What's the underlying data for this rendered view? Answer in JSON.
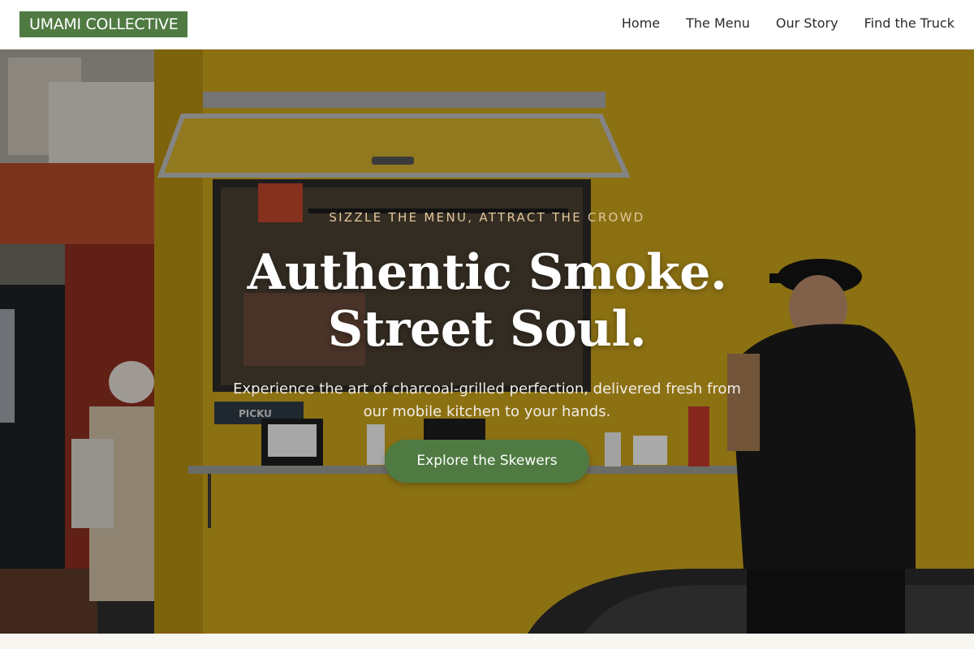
{
  "header": {
    "logo_text": "UMAMI COLLECTIVE",
    "nav": [
      {
        "label": "Home"
      },
      {
        "label": "The Menu"
      },
      {
        "label": "Our Story"
      },
      {
        "label": "Find the Truck"
      }
    ]
  },
  "hero": {
    "eyebrow": "SIZZLE THE MENU, ATTRACT THE CROWD",
    "headline_line1": "Authentic Smoke.",
    "headline_line2": "Street Soul.",
    "subtext": "Experience the art of charcoal-grilled perfection, delivered fresh from our mobile kitchen to your hands.",
    "cta_label": "Explore the Skewers",
    "truck_window_sign": "PICKU"
  },
  "colors": {
    "brand_green": "#4f7a42",
    "truck_yellow": "#c9a21c",
    "eyebrow_tan": "#e2c79c",
    "page_bg": "#f8f6f1"
  }
}
